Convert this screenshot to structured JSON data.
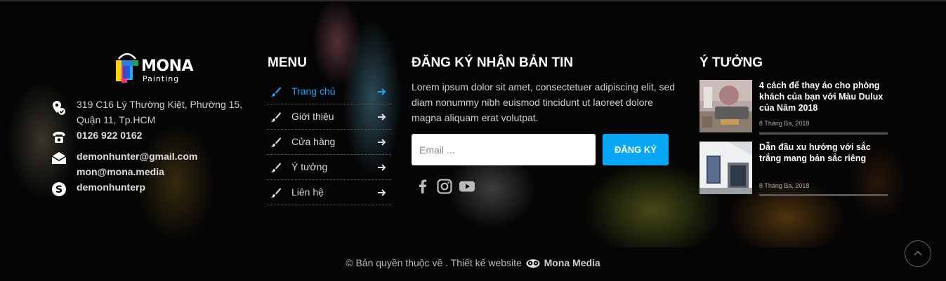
{
  "brand": {
    "logo_text": "MONA",
    "logo_sub": "Painting"
  },
  "contact": {
    "address_line1": "319 C16 Lý Thường Kiệt, Phường 15,",
    "address_line2": "Quận 11, Tp.HCM",
    "phone": "0126 922 0162",
    "email1": "demonhunter@gmail.com",
    "email2": "mon@mona.media",
    "skype": "demonhunterp"
  },
  "menu": {
    "title": "MENU",
    "items": [
      {
        "label": "Trang chủ",
        "active": true
      },
      {
        "label": "Giới thiệu",
        "active": false
      },
      {
        "label": "Cửa hàng",
        "active": false
      },
      {
        "label": "Ý tưởng",
        "active": false
      },
      {
        "label": "Liên hệ",
        "active": false
      }
    ]
  },
  "newsletter": {
    "title": "ĐĂNG KÝ NHẬN BẢN TIN",
    "text": "Lorem ipsum dolor sit amet, consectetuer adipiscing elit, sed diam nonummy nibh euismod tincidunt ut laoreet dolore magna aliquam erat volutpat.",
    "email_placeholder": "Email ...",
    "email_value": "",
    "button_label": "ĐĂNG KÝ",
    "social_icons": [
      "facebook-icon",
      "instagram-icon",
      "youtube-icon"
    ]
  },
  "ideas": {
    "title": "Ý TƯỞNG",
    "posts": [
      {
        "title": "4 cách để thay áo cho phòng khách của bạn với Màu Dulux của Năm 2018",
        "date": "8 Tháng Ba, 2018"
      },
      {
        "title": "Dẫn đầu xu hướng với sắc trắng mang bản sắc riêng",
        "date": "8 Tháng Ba, 2018"
      }
    ]
  },
  "footer_bottom": {
    "copyright": "© Bản quyền thuộc về . Thiết kế website",
    "brand": "Mona Media"
  },
  "colors": {
    "accent": "#08a7f5",
    "active_link": "#1aa3ff",
    "background": "#050505"
  }
}
